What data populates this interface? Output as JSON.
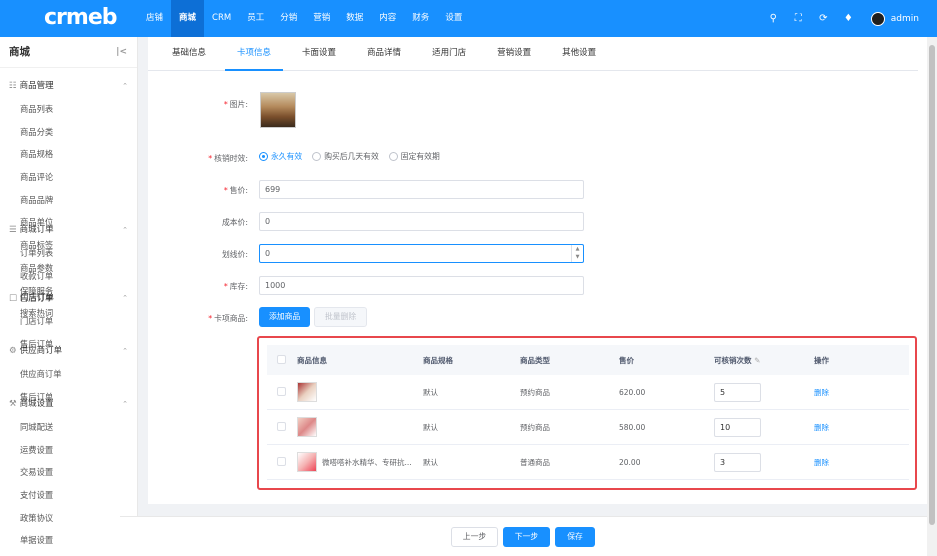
{
  "app": {
    "logo": "crmeb",
    "user": "admin"
  },
  "topnav": [
    "店铺",
    "商城",
    "CRM",
    "员工",
    "分销",
    "营销",
    "数据",
    "内容",
    "财务",
    "设置"
  ],
  "topnav_active": 1,
  "sidebar": {
    "title": "商城",
    "groups": [
      {
        "title": "商品管理",
        "icon": "grid-icon",
        "items": [
          "商品列表",
          "商品分类",
          "商品规格",
          "商品评论",
          "商品品牌",
          "商品单位",
          "商品标签",
          "商品参数",
          "保障服务",
          "搜索热词"
        ]
      },
      {
        "title": "商城订单",
        "icon": "list-icon",
        "items": [
          "订单列表",
          "收款订单",
          "售后订单"
        ]
      },
      {
        "title": "门店订单",
        "icon": "store-icon",
        "items": [
          "门店订单",
          "售后订单"
        ]
      },
      {
        "title": "供应商订单",
        "icon": "supplier-icon",
        "items": [
          "供应商订单",
          "售后订单"
        ]
      },
      {
        "title": "商城设置",
        "icon": "wrench-icon",
        "items": [
          "同城配送",
          "运费设置",
          "交易设置",
          "支付设置",
          "政策协议",
          "单据设置"
        ]
      }
    ]
  },
  "tabs": [
    "基础信息",
    "卡项信息",
    "卡面设置",
    "商品详情",
    "适用门店",
    "营销设置",
    "其他设置"
  ],
  "tabs_active": 1,
  "form": {
    "image_label": "图片:",
    "verify_label": "核销时效:",
    "verify_options": [
      "永久有效",
      "购买后几天有效",
      "固定有效期"
    ],
    "price_label": "售价:",
    "price_value": "699",
    "cost_label": "成本价:",
    "cost_value": "0",
    "line_label": "划线价:",
    "line_value": "0",
    "stock_label": "库存:",
    "stock_value": "1000",
    "card_goods_label": "卡项商品:",
    "add_goods": "添加商品",
    "batch_delete": "批量删除"
  },
  "table": {
    "headers": [
      "商品信息",
      "商品规格",
      "商品类型",
      "售价",
      "可核销次数",
      "操作"
    ],
    "rows": [
      {
        "name": "",
        "spec": "默认",
        "type": "预约商品",
        "price": "620.00",
        "count": "5",
        "op": "删除"
      },
      {
        "name": "",
        "spec": "默认",
        "type": "预约商品",
        "price": "580.00",
        "count": "10",
        "op": "删除"
      },
      {
        "name": "微嗒嗒补水精华、专研抗...",
        "spec": "默认",
        "type": "普通商品",
        "price": "20.00",
        "count": "3",
        "op": "删除"
      }
    ]
  },
  "footer": {
    "prev": "上一步",
    "next": "下一步",
    "save": "保存"
  },
  "colors": {
    "primary": "#1890ff",
    "highlight": "#e8474c"
  }
}
